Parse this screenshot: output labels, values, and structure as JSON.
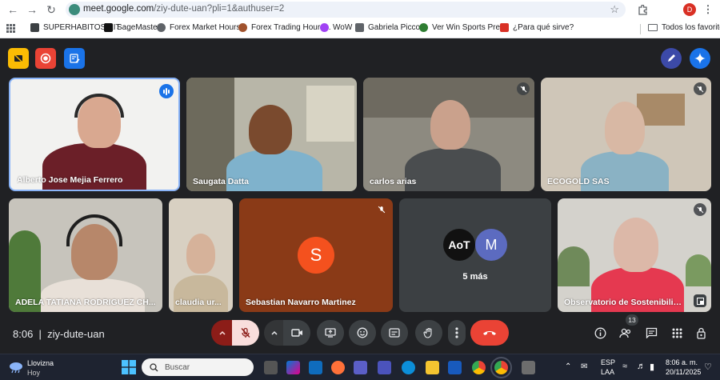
{
  "browser": {
    "url_host": "meet.google.com",
    "url_path": "/ziy-dute-uan?pli=1&authuser=2",
    "profile_initial": "D",
    "bookmarks": [
      {
        "label": "SUPERHABITOS KIT",
        "color": "#3c4043"
      },
      {
        "label": "SageMaster",
        "color": "#111111"
      },
      {
        "label": "Forex Market Hours...",
        "color": "#5f6368"
      },
      {
        "label": "Forex Trading Hours...",
        "color": "#a0522d"
      },
      {
        "label": "WoW",
        "color": "#a142f4"
      },
      {
        "label": "Gabriela Piccott",
        "color": "#5f6368"
      },
      {
        "label": "Ver Win Sports Pre...",
        "color": "#2e7d32"
      },
      {
        "label": "¿Para qué sirve?",
        "color": "#d93025"
      }
    ],
    "all_bookmarks": "Todos los favoritos"
  },
  "meeting": {
    "time": "8:06",
    "code": "ziy-dute-uan",
    "people_count": "13",
    "more_label": "5 más",
    "avatar_s": "S",
    "avatar_m": "M",
    "aot_logo": "AoT"
  },
  "participants": [
    {
      "name": "Alberto Jose Mejia Ferrero"
    },
    {
      "name": "Saugata Datta"
    },
    {
      "name": "carlos arias"
    },
    {
      "name": "ECOGOLD SAS"
    },
    {
      "name": "ADELA TATIANA RODRIGUEZ CH..."
    },
    {
      "name": "claudia ur..."
    },
    {
      "name": "Sebastian Navarro Martinez"
    },
    {
      "name": "Observatorio de Sostenibilid..."
    }
  ],
  "taskbar": {
    "weather_title": "Llovizna",
    "weather_sub": "Hoy",
    "search_placeholder": "Buscar",
    "lang_1": "ESP",
    "lang_2": "LAA",
    "clock_time": "8:06 a. m.",
    "clock_date": "20/11/2025"
  },
  "colors": {
    "meet_bg": "#202124",
    "leave_red": "#ea4335",
    "mic_off_bg": "#f9dedc",
    "accent_blue": "#1a73e8",
    "sebastian_tile": "#8a3a17",
    "avatar_s": "#f4511e",
    "avatar_m": "#5c6bc0"
  }
}
